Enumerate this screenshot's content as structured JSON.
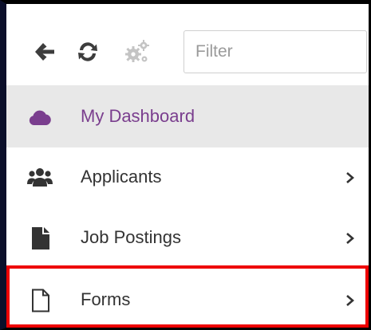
{
  "toolbar": {
    "back_icon": "arrow-left-icon",
    "refresh_icon": "refresh-icon",
    "settings_icon": "gears-icon",
    "filter_placeholder": "Filter",
    "filter_value": ""
  },
  "menu": {
    "items": [
      {
        "label": "My Dashboard",
        "icon": "cloud-icon",
        "active": true,
        "has_submenu": false
      },
      {
        "label": "Applicants",
        "icon": "users-icon",
        "active": false,
        "has_submenu": true
      },
      {
        "label": "Job Postings",
        "icon": "file-icon",
        "active": false,
        "has_submenu": true
      },
      {
        "label": "Forms",
        "icon": "file-outline-icon",
        "active": false,
        "has_submenu": true,
        "highlighted": true
      }
    ]
  },
  "colors": {
    "active_text": "#7a3e8e",
    "active_bg": "#e8e8e8",
    "highlight_border": "#ee0000",
    "icon_dark": "#333333",
    "icon_muted": "#bdbdbd"
  }
}
